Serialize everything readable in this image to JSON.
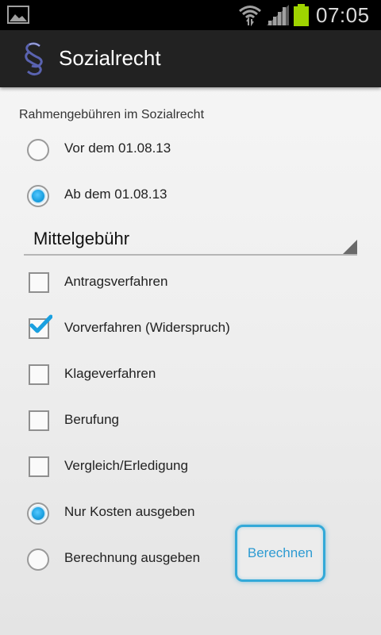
{
  "status_bar": {
    "time": "07:05",
    "icons": [
      "gallery-icon",
      "wifi-icon",
      "signal-icon",
      "battery-icon"
    ],
    "battery_color": "#9fd400"
  },
  "action_bar": {
    "title": "Sozialrecht",
    "icon": "section-sign-logo-icon",
    "background": "#222222"
  },
  "form": {
    "section_label": "Rahmengebühren im Sozialrecht",
    "date_options": [
      {
        "label": "Vor dem 01.08.13",
        "checked": false
      },
      {
        "label": "Ab dem 01.08.13",
        "checked": true
      }
    ],
    "fee_select": {
      "value": "Mittelgebühr"
    },
    "procedures": [
      {
        "label": "Antragsverfahren",
        "checked": false
      },
      {
        "label": "Vorverfahren (Widerspruch)",
        "checked": true
      },
      {
        "label": "Klageverfahren",
        "checked": false
      },
      {
        "label": "Berufung",
        "checked": false
      },
      {
        "label": "Vergleich/Erledigung",
        "checked": false
      }
    ],
    "output_options": [
      {
        "label": "Nur Kosten ausgeben",
        "checked": true
      },
      {
        "label": "Berechnung ausgeben",
        "checked": false
      }
    ],
    "calculate_button": "Berechnen"
  },
  "colors": {
    "accent": "#33a9d8",
    "radio_fill": "#1aa0e0",
    "checkmark": "#1aa0e0"
  }
}
